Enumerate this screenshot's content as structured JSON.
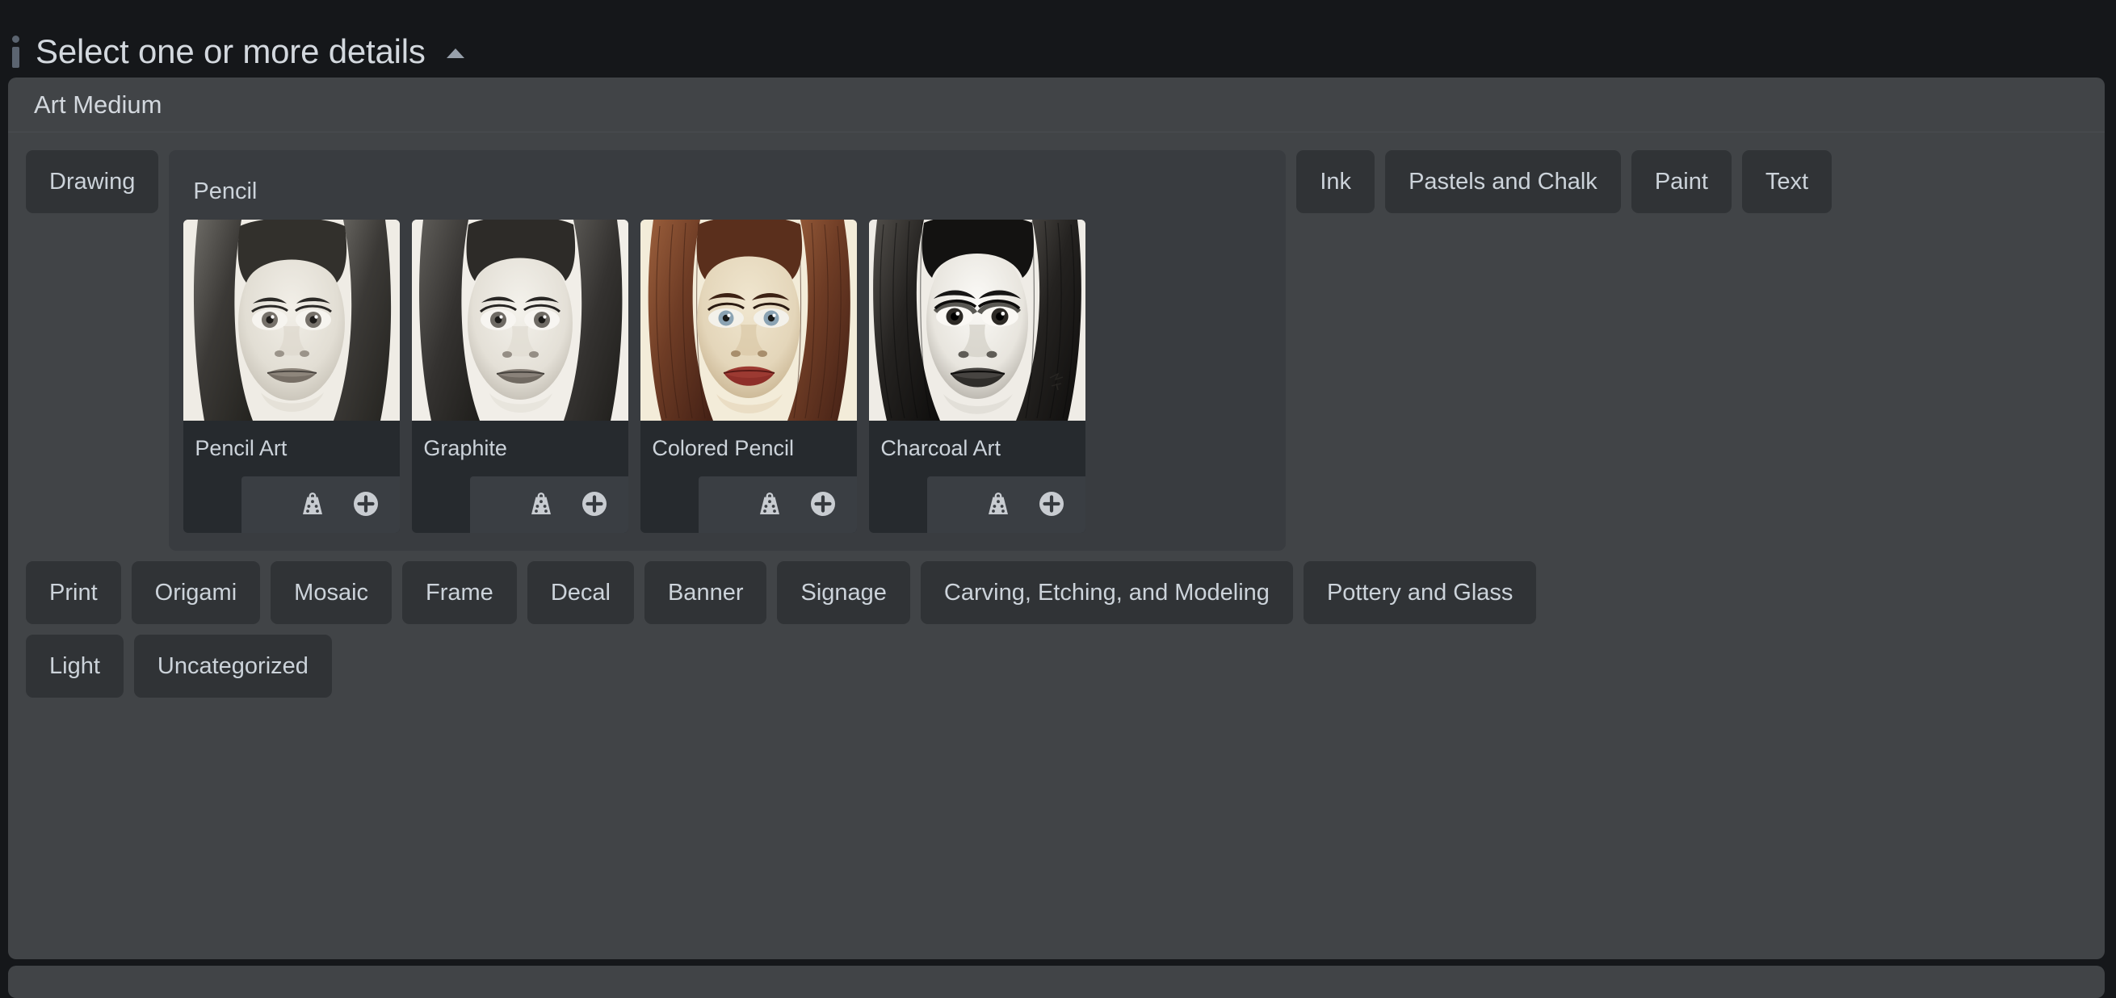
{
  "header": {
    "title": "Select one or more details",
    "info_icon": "info-icon",
    "collapse_icon": "chevron-up-icon"
  },
  "section": {
    "title": "Art Medium"
  },
  "chips_row1_before": [
    {
      "label": "Drawing"
    }
  ],
  "expanded_group": {
    "label": "Pencil",
    "cards": [
      {
        "label": "Pencil Art",
        "thumb": "pencil-portrait-grayscale",
        "weight_icon": "weight-icon",
        "add_icon": "plus-circle-icon"
      },
      {
        "label": "Graphite",
        "thumb": "graphite-portrait-grayscale",
        "weight_icon": "weight-icon",
        "add_icon": "plus-circle-icon"
      },
      {
        "label": "Colored Pencil",
        "thumb": "colored-pencil-portrait",
        "weight_icon": "weight-icon",
        "add_icon": "plus-circle-icon"
      },
      {
        "label": "Charcoal Art",
        "thumb": "charcoal-portrait-highcontrast",
        "weight_icon": "weight-icon",
        "add_icon": "plus-circle-icon"
      }
    ]
  },
  "chips_row1_after": [
    {
      "label": "Ink"
    },
    {
      "label": "Pastels and Chalk"
    },
    {
      "label": "Paint"
    },
    {
      "label": "Text"
    }
  ],
  "chips_row2": [
    {
      "label": "Print"
    },
    {
      "label": "Origami"
    },
    {
      "label": "Mosaic"
    },
    {
      "label": "Frame"
    },
    {
      "label": "Decal"
    },
    {
      "label": "Banner"
    },
    {
      "label": "Signage"
    },
    {
      "label": "Carving, Etching, and Modeling"
    },
    {
      "label": "Pottery and Glass"
    }
  ],
  "chips_row3": [
    {
      "label": "Light"
    },
    {
      "label": "Uncategorized"
    }
  ],
  "colors": {
    "page_background": "#15171a",
    "panel_background": "#414447",
    "chip_background": "#303336",
    "group_background": "#393c40",
    "card_background": "#262a2e",
    "card_actions_background": "#3a3e43",
    "text_primary": "#ccd3da",
    "icon_fill": "#c8ccd1",
    "info_icon": "#5b6470"
  }
}
